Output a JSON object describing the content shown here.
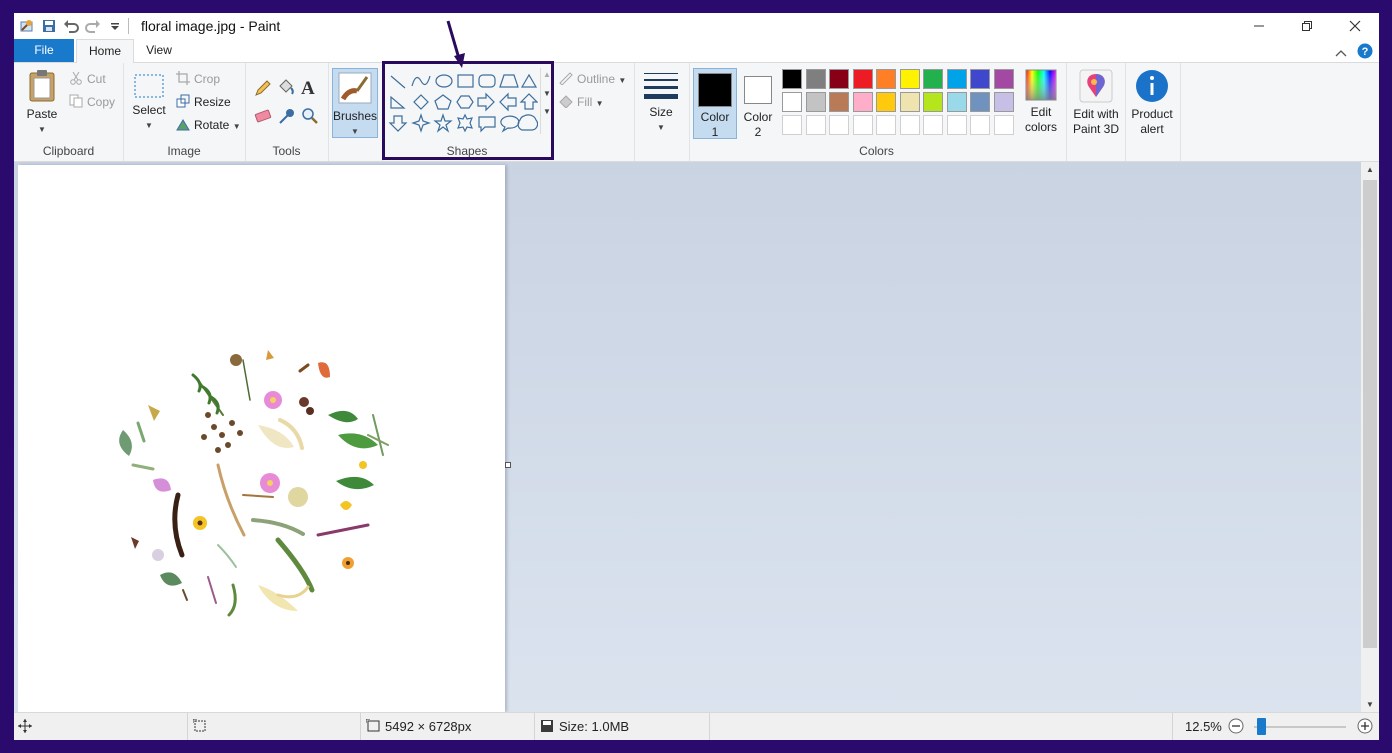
{
  "window": {
    "title": "floral image.jpg - Paint",
    "controls": [
      "minimize",
      "restore",
      "close"
    ]
  },
  "tabs": {
    "file": "File",
    "home": "Home",
    "view": "View"
  },
  "ribbon": {
    "clipboard": {
      "label": "Clipboard",
      "paste": "Paste",
      "cut": "Cut",
      "copy": "Copy"
    },
    "image": {
      "label": "Image",
      "select": "Select",
      "crop": "Crop",
      "resize": "Resize",
      "rotate": "Rotate"
    },
    "tools": {
      "label": "Tools"
    },
    "brushes": {
      "label": "Brushes"
    },
    "shapes": {
      "label": "Shapes",
      "outline": "Outline",
      "fill": "Fill"
    },
    "size": {
      "label": "Size"
    },
    "colors": {
      "label": "Colors",
      "color1": "Color",
      "color1_num": "1",
      "color2": "Color",
      "color2_num": "2",
      "edit_colors_1": "Edit",
      "edit_colors_2": "colors",
      "palette_row1": [
        "#000000",
        "#7f7f7f",
        "#880015",
        "#ed1c24",
        "#ff7f27",
        "#fff200",
        "#22b14c",
        "#00a2e8",
        "#3f48cc",
        "#a349a4"
      ],
      "palette_row2": [
        "#ffffff",
        "#c3c3c3",
        "#b97a57",
        "#ffaec9",
        "#ffc90e",
        "#efe4b0",
        "#b5e61d",
        "#99d9ea",
        "#7092be",
        "#c8bfe7"
      ]
    },
    "paint3d": {
      "line1": "Edit with",
      "line2": "Paint 3D"
    },
    "product_alert": {
      "line1": "Product",
      "line2": "alert"
    }
  },
  "status": {
    "dimensions": "5492 × 6728px",
    "size": "Size: 1.0MB",
    "zoom": "12.5%"
  },
  "accent": "#1979ca",
  "annotation_color": "#2a0a5c"
}
